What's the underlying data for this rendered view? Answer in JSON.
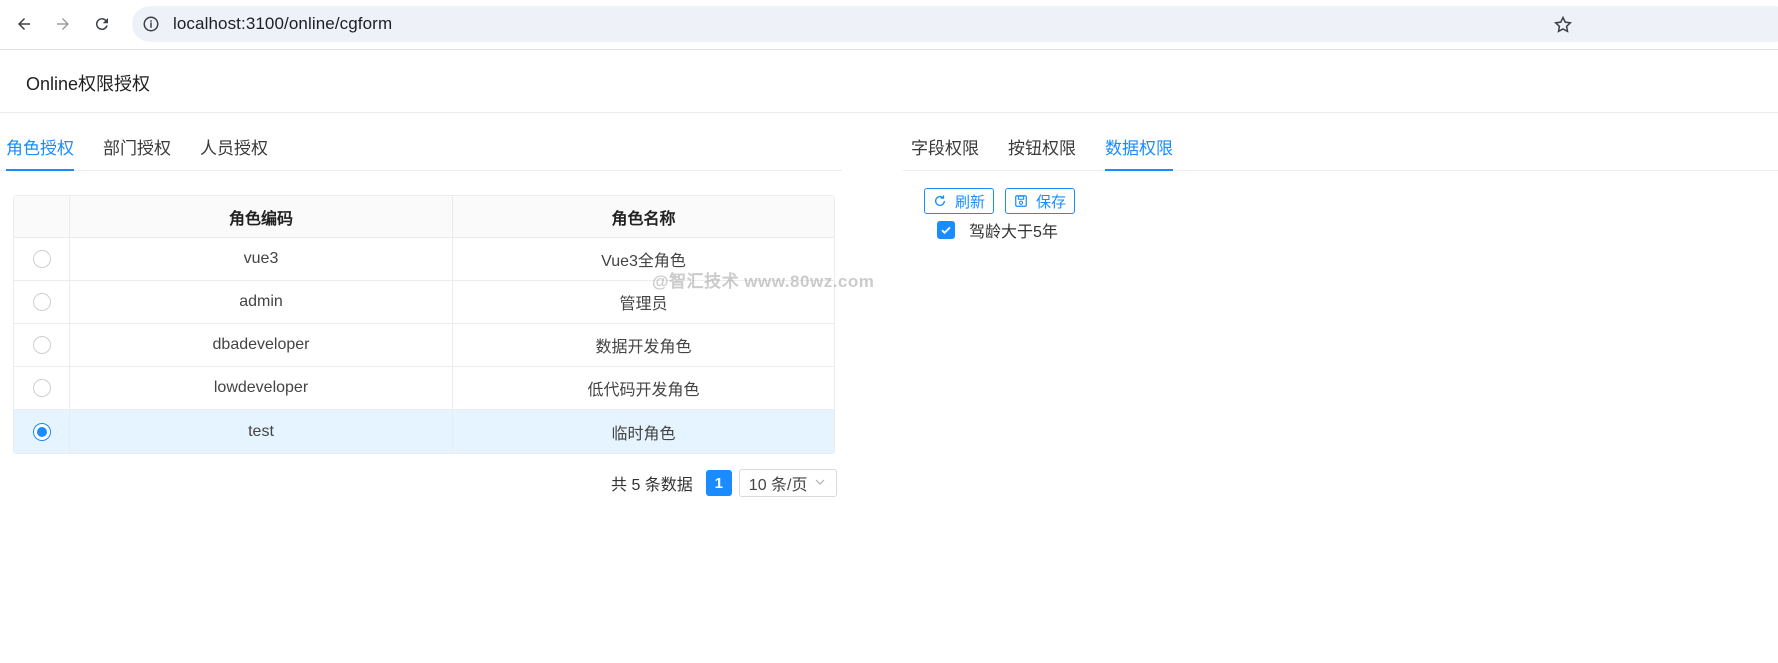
{
  "browser": {
    "url": "localhost:3100/online/cgform",
    "icons": [
      "back-icon",
      "forward-icon",
      "reload-icon",
      "site-info-icon",
      "bookmark-star-icon"
    ]
  },
  "page": {
    "title": "Online权限授权"
  },
  "left_tabs": [
    {
      "label": "角色授权",
      "active": true
    },
    {
      "label": "部门授权",
      "active": false
    },
    {
      "label": "人员授权",
      "active": false
    }
  ],
  "right_tabs": [
    {
      "label": "字段权限",
      "active": false
    },
    {
      "label": "按钮权限",
      "active": false
    },
    {
      "label": "数据权限",
      "active": true
    }
  ],
  "table": {
    "columns": [
      "角色编码",
      "角色名称"
    ],
    "rows": [
      {
        "code": "vue3",
        "name": "Vue3全角色",
        "selected": false
      },
      {
        "code": "admin",
        "name": "管理员",
        "selected": false
      },
      {
        "code": "dbadeveloper",
        "name": "数据开发角色",
        "selected": false
      },
      {
        "code": "lowdeveloper",
        "name": "低代码开发角色",
        "selected": false
      },
      {
        "code": "test",
        "name": "临时角色",
        "selected": true
      }
    ]
  },
  "pagination": {
    "total_text": "共 5 条数据",
    "current_page": "1",
    "page_size": "10 条/页"
  },
  "data_permission": {
    "refresh_label": "刷新",
    "save_label": "保存",
    "rules": [
      {
        "label": "驾龄大于5年",
        "checked": true
      }
    ]
  },
  "watermark": "@智汇技术 www.80wz.com",
  "colors": {
    "accent": "#1a8cff",
    "selected_row": "#e6f4ff",
    "header_bg": "#fafafa"
  }
}
